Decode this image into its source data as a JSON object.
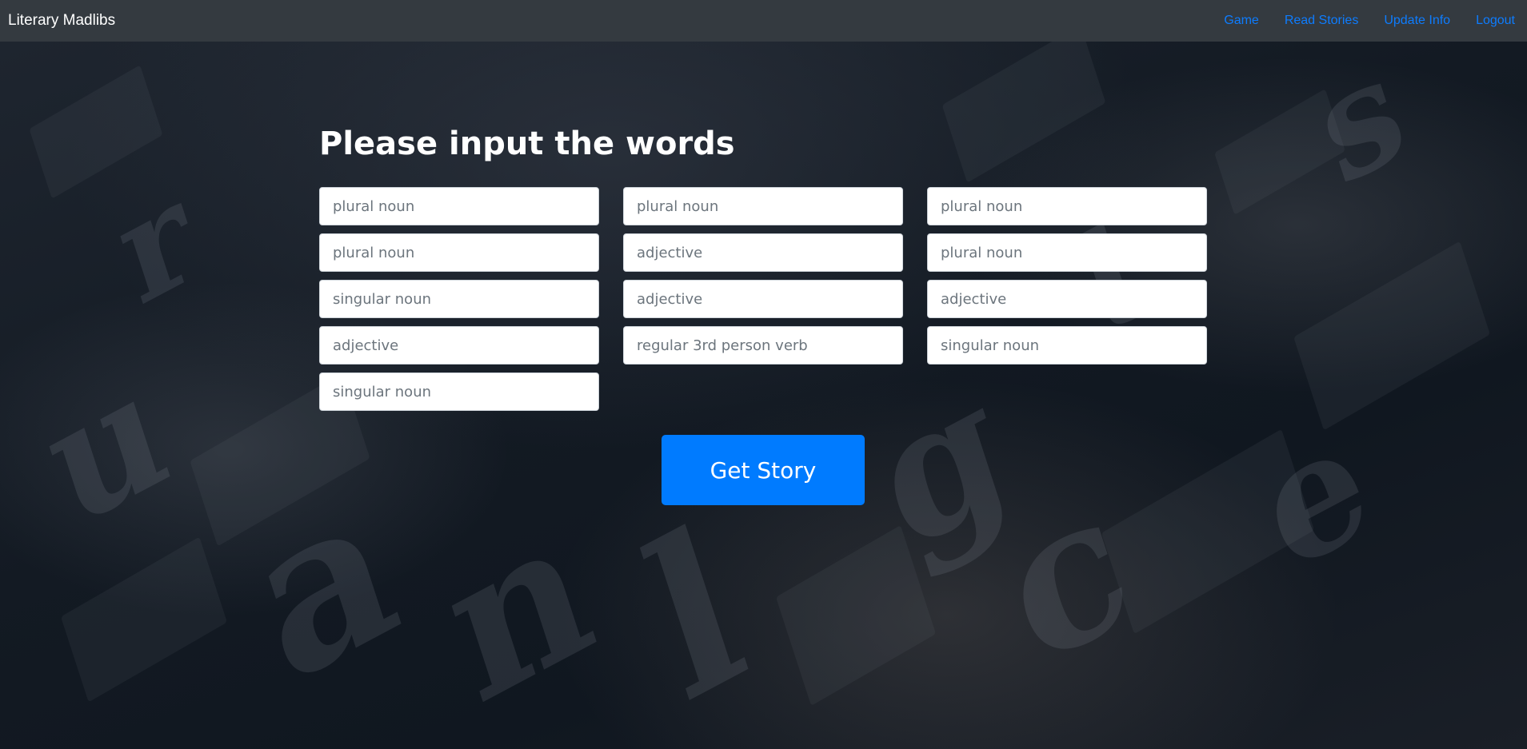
{
  "navbar": {
    "brand": "Literary Madlibs",
    "links": [
      {
        "label": "Game"
      },
      {
        "label": "Read Stories"
      },
      {
        "label": "Update Info"
      },
      {
        "label": "Logout"
      }
    ],
    "background_color": "#343a40",
    "link_color": "#0d7cff"
  },
  "form": {
    "heading": "Please input the words",
    "fields": [
      {
        "placeholder": "plural noun"
      },
      {
        "placeholder": "plural noun"
      },
      {
        "placeholder": "plural noun"
      },
      {
        "placeholder": "plural noun"
      },
      {
        "placeholder": "adjective"
      },
      {
        "placeholder": "plural noun"
      },
      {
        "placeholder": "singular noun"
      },
      {
        "placeholder": "adjective"
      },
      {
        "placeholder": "adjective"
      },
      {
        "placeholder": "adjective"
      },
      {
        "placeholder": "regular 3rd person verb"
      },
      {
        "placeholder": "singular noun"
      },
      {
        "placeholder": "singular noun"
      }
    ],
    "submit_label": "Get Story",
    "button_color": "#007bff"
  }
}
